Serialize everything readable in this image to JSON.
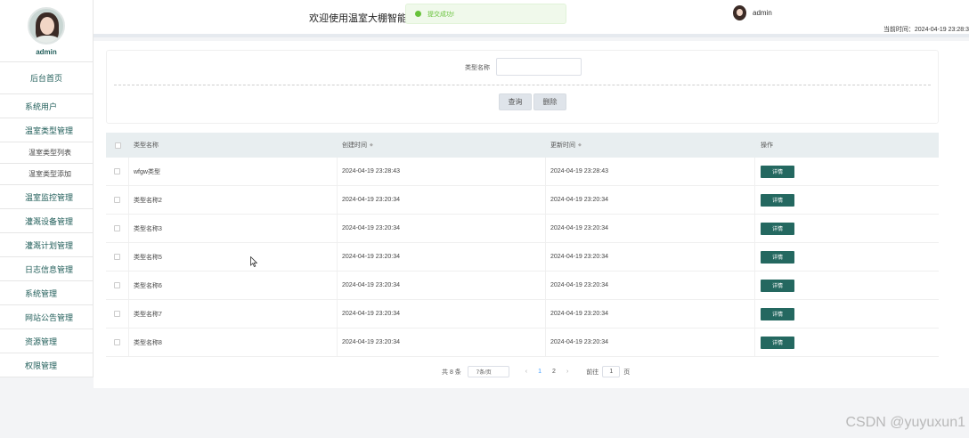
{
  "sidebar": {
    "user_name": "admin",
    "home": "后台首页",
    "items": [
      {
        "label": "系统用户"
      },
      {
        "label": "温室类型管理"
      },
      {
        "label": "温室类型列表"
      },
      {
        "label": "温室类型添加"
      },
      {
        "label": "温室监控管理"
      },
      {
        "label": "灌溉设备管理"
      },
      {
        "label": "灌溉计划管理"
      },
      {
        "label": "日志信息管理"
      },
      {
        "label": "系统管理"
      },
      {
        "label": "网站公告管理"
      },
      {
        "label": "资源管理"
      },
      {
        "label": "权限管理"
      }
    ]
  },
  "header": {
    "welcome": "欢迎使用温室大棚智能",
    "toast": "提交成功!",
    "user_name": "admin",
    "clock": "当前时间：2024-04-19 23:28:3"
  },
  "search": {
    "label": "类型名称",
    "placeholder": "",
    "query_btn": "查询",
    "delete_btn": "删除"
  },
  "table": {
    "headers": {
      "name": "类型名称",
      "created": "创建时间",
      "updated": "更新时间",
      "op": "操作"
    },
    "detail_label": "详情",
    "rows": [
      {
        "name": "wfgw类型",
        "created": "2024-04-19 23:28:43",
        "updated": "2024-04-19 23:28:43"
      },
      {
        "name": "类型名称2",
        "created": "2024-04-19 23:20:34",
        "updated": "2024-04-19 23:20:34"
      },
      {
        "name": "类型名称3",
        "created": "2024-04-19 23:20:34",
        "updated": "2024-04-19 23:20:34"
      },
      {
        "name": "类型名称5",
        "created": "2024-04-19 23:20:34",
        "updated": "2024-04-19 23:20:34"
      },
      {
        "name": "类型名称6",
        "created": "2024-04-19 23:20:34",
        "updated": "2024-04-19 23:20:34"
      },
      {
        "name": "类型名称7",
        "created": "2024-04-19 23:20:34",
        "updated": "2024-04-19 23:20:34"
      },
      {
        "name": "类型名称8",
        "created": "2024-04-19 23:20:34",
        "updated": "2024-04-19 23:20:34"
      }
    ]
  },
  "pager": {
    "total": "共 8 条",
    "page_size": "7条/页",
    "prev": "‹",
    "pages": [
      "1",
      "2"
    ],
    "next": "›",
    "goto_label": "前往",
    "goto_value": "1",
    "goto_suffix": "页"
  },
  "watermark": "CSDN @yuyuxun1"
}
